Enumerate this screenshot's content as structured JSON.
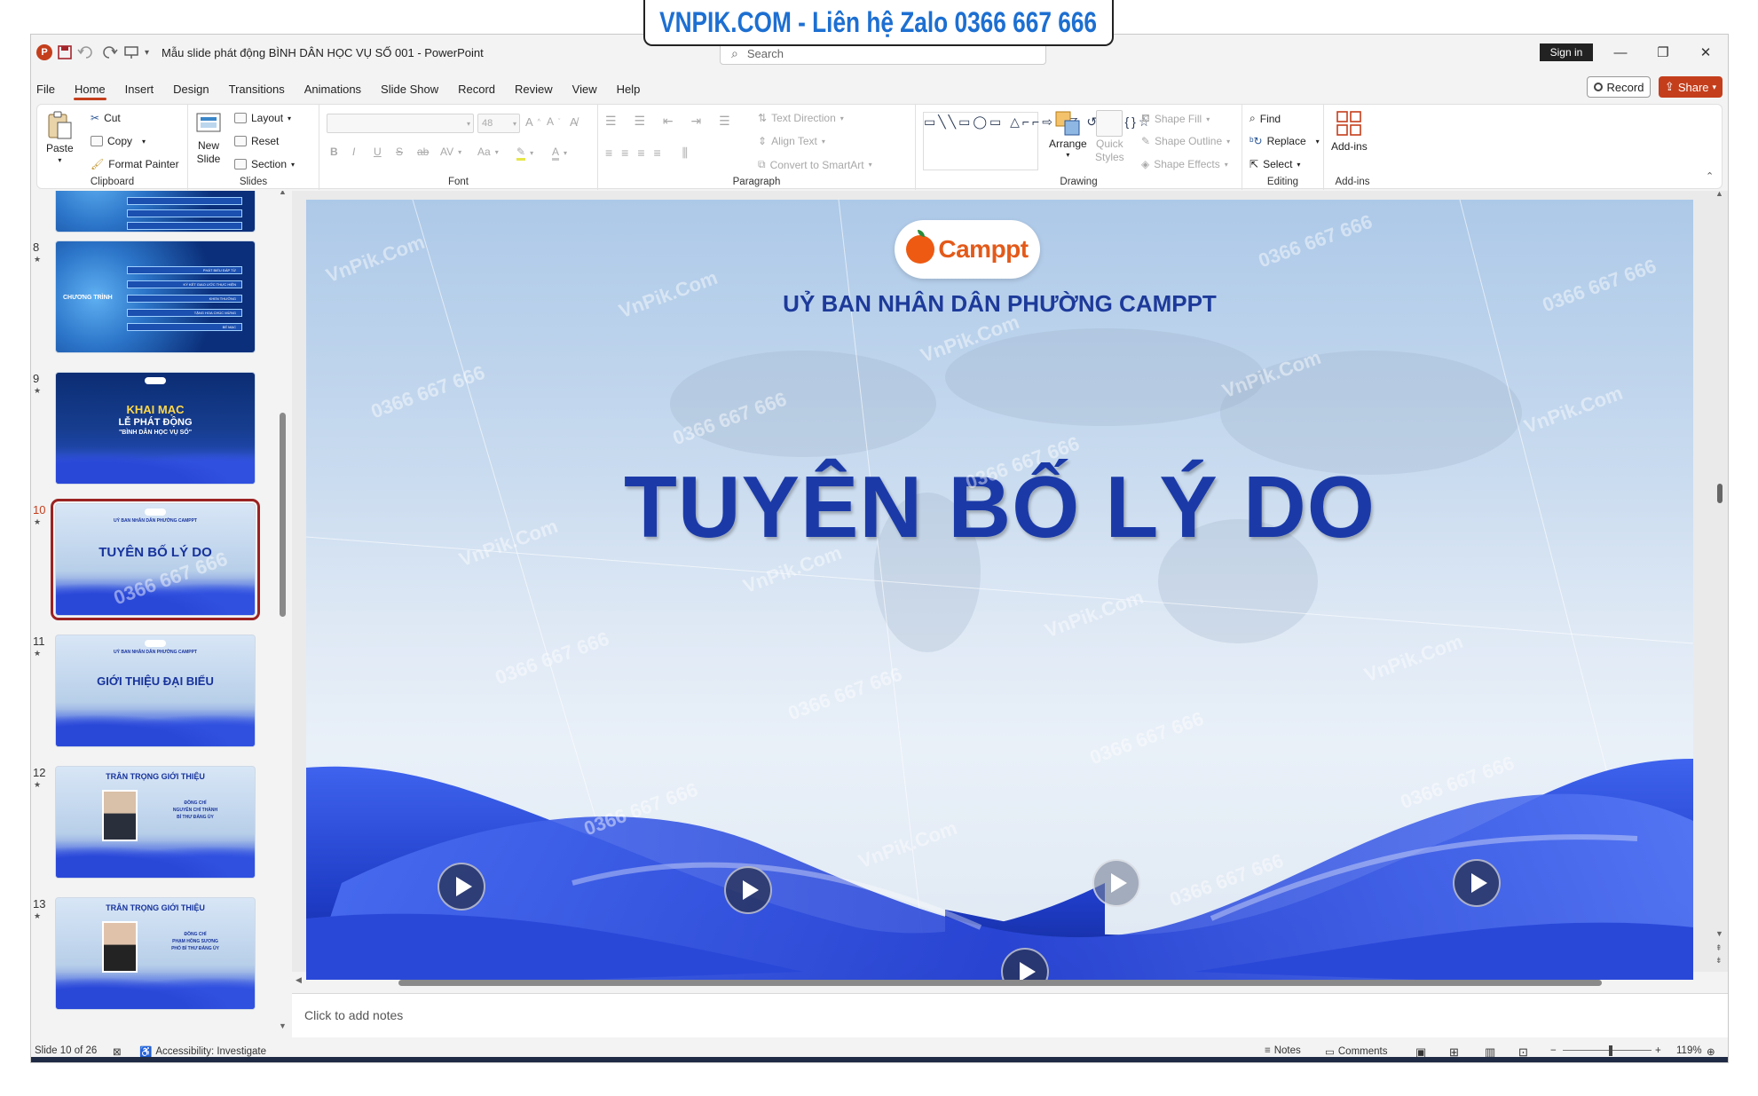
{
  "banner": {
    "text": "VNPIK.COM - Liên hệ Zalo 0366 667 666"
  },
  "titlebar": {
    "app_icon": "P",
    "document_title": "Mẫu slide phát động BÌNH DÂN HỌC VỤ SỐ 001  -  PowerPoint",
    "search_placeholder": "Search",
    "sign_in": "Sign in",
    "icons": [
      "save-icon",
      "undo-icon",
      "redo-icon",
      "present-icon",
      "customize-icon"
    ]
  },
  "menu": {
    "tabs": [
      "File",
      "Home",
      "Insert",
      "Design",
      "Transitions",
      "Animations",
      "Slide Show",
      "Record",
      "Review",
      "View",
      "Help"
    ],
    "active": "Home",
    "record": "Record",
    "share": "Share"
  },
  "ribbon": {
    "clipboard": {
      "label": "Clipboard",
      "paste": "Paste",
      "cut": "Cut",
      "copy": "Copy",
      "format_painter": "Format Painter"
    },
    "slides": {
      "label": "Slides",
      "new_slide_1": "New",
      "new_slide_2": "Slide",
      "layout": "Layout",
      "reset": "Reset",
      "section": "Section"
    },
    "font": {
      "label": "Font",
      "size": "48",
      "bold": "B",
      "italic": "I",
      "underline": "U",
      "strike": "S",
      "shadow": "ab",
      "spacing": "AV",
      "case": "Aa"
    },
    "paragraph": {
      "label": "Paragraph",
      "text_direction": "Text Direction",
      "align_text": "Align Text",
      "convert": "Convert to SmartArt"
    },
    "drawing": {
      "label": "Drawing",
      "arrange": "Arrange",
      "quick_styles_1": "Quick",
      "quick_styles_2": "Styles",
      "shape_fill": "Shape Fill",
      "shape_outline": "Shape Outline",
      "shape_effects": "Shape Effects"
    },
    "editing": {
      "label": "Editing",
      "find": "Find",
      "replace": "Replace",
      "select": "Select"
    },
    "addins": {
      "label": "Add-ins",
      "addins": "Add-ins"
    }
  },
  "thumbnails": [
    {
      "num": "",
      "kind": "tech-partial"
    },
    {
      "num": "8",
      "kind": "agenda",
      "title": "CHƯƠNG TRÌNH",
      "rows": [
        "PHÁT BIỂU ĐÁP TỪ",
        "KÝ KẾT GIAO ƯỚC THỰC HIỆN",
        "KHEN THƯỞNG",
        "TẶNG HOA CHÚC MỪNG",
        "BẾ MẠC"
      ]
    },
    {
      "num": "9",
      "kind": "opening",
      "line1": "KHAI MẠC",
      "line2": "LỄ PHÁT ĐỘNG",
      "line3": "\"BÌNH DÂN HỌC VỤ SỐ\""
    },
    {
      "num": "10",
      "kind": "title",
      "title": "TUYÊN BỐ LÝ DO",
      "selected": true
    },
    {
      "num": "11",
      "kind": "title",
      "title": "GIỚI THIỆU ĐẠI BIỂU"
    },
    {
      "num": "12",
      "kind": "person",
      "title": "TRÂN TRỌNG GIỚI THIỆU",
      "l1": "ĐỒNG CHÍ",
      "l2": "NGUYỄN CHÍ THÀNH",
      "l3": "BÍ THƯ ĐẢNG ỦY"
    },
    {
      "num": "13",
      "kind": "person",
      "title": "TRÂN TRỌNG GIỚI THIỆU",
      "l1": "ĐỒNG CHÍ",
      "l2": "PHẠM HỒNG SƯƠNG",
      "l3": "PHÓ BÍ THƯ ĐẢNG ỦY"
    }
  ],
  "slide": {
    "logo_text": "Camppt",
    "org": "UỶ BAN NHÂN DÂN PHƯỜNG CAMPPT",
    "title": "TUYÊN BỐ LÝ DO"
  },
  "notes_placeholder": "Click to add notes",
  "status": {
    "slide_count": "Slide 10 of 26",
    "accessibility": "Accessibility: Investigate",
    "notes": "Notes",
    "comments": "Comments",
    "zoom": "119%"
  },
  "watermarks": [
    "VnPik.Com",
    "0366 667 666"
  ],
  "colors": {
    "accent": "#c43e1c",
    "title_blue": "#1b3aa8",
    "banner_blue": "#1d6fd1"
  }
}
